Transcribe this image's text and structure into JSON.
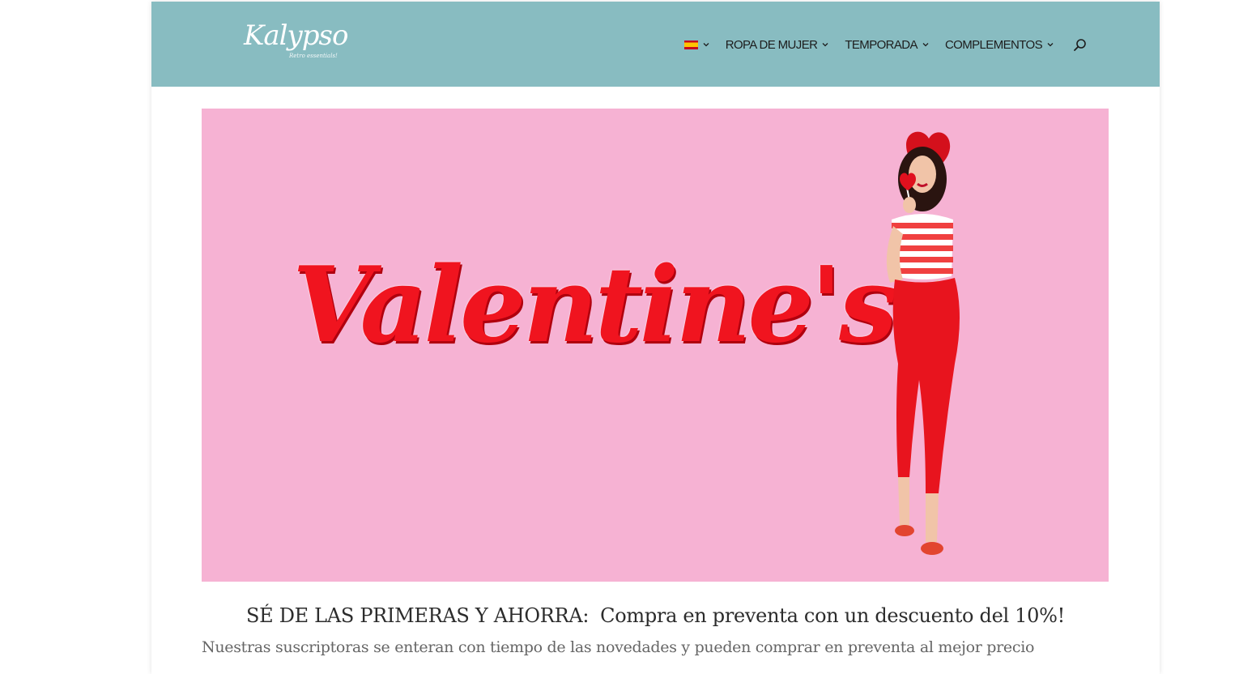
{
  "header": {
    "background_color": "#88bcc1",
    "logo": {
      "text": "Kalypso",
      "tagline": "Retro essentials!"
    },
    "language": {
      "flag_icon": "spain-flag-icon",
      "selected": "es"
    },
    "nav": [
      {
        "label": "ROPA DE MUJER"
      },
      {
        "label": "TEMPORADA"
      },
      {
        "label": "COMPLEMENTOS"
      }
    ],
    "search_icon": "search-icon"
  },
  "banner": {
    "background_color": "#f6b2d3",
    "title": "Valentine's",
    "title_color": "#f0141f",
    "image": "woman-in-red-outfit-with-heart-hat"
  },
  "promo": {
    "lead": "SÉ DE LAS PRIMERAS Y AHORRA:",
    "text": "Compra en preventa con un descuento del 10%!"
  },
  "subtext": "Nuestras suscriptoras se enteran con tiempo de las novedades y pueden comprar en preventa al mejor precio"
}
